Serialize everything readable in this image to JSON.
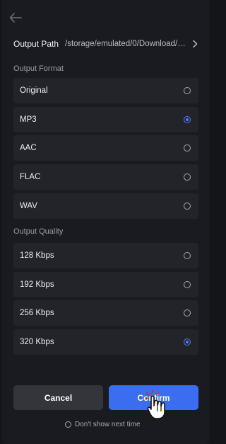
{
  "header": {
    "back_icon": "arrow-left-icon"
  },
  "output_path": {
    "label": "Output Path",
    "value": "/storage/emulated/0/Download/T...",
    "chevron_icon": "chevron-right-icon"
  },
  "output_format": {
    "title": "Output Format",
    "options": [
      {
        "label": "Original",
        "selected": false
      },
      {
        "label": "MP3",
        "selected": true
      },
      {
        "label": "AAC",
        "selected": false
      },
      {
        "label": "FLAC",
        "selected": false
      },
      {
        "label": "WAV",
        "selected": false
      }
    ]
  },
  "output_quality": {
    "title": "Output Quality",
    "options": [
      {
        "label": "128 Kbps",
        "selected": false
      },
      {
        "label": "192 Kbps",
        "selected": false
      },
      {
        "label": "256 Kbps",
        "selected": false
      },
      {
        "label": "320 Kbps",
        "selected": true
      }
    ]
  },
  "actions": {
    "cancel_label": "Cancel",
    "confirm_label": "Confirm"
  },
  "dont_show": {
    "label": "Don't show next time",
    "checked": false
  },
  "colors": {
    "accent": "#3a6df0",
    "background": "#1a1b20",
    "option_bg": "#23242a"
  },
  "overlay": {
    "cursor_icon": "hand-pointer-cursor-icon"
  }
}
